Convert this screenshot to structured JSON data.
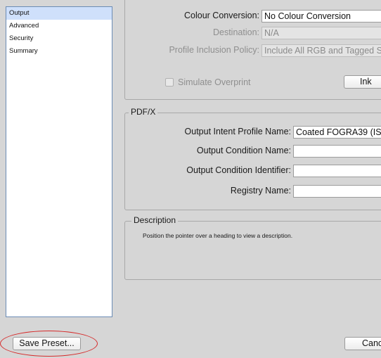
{
  "sidebar": {
    "items": [
      {
        "label": "Output",
        "selected": true
      },
      {
        "label": "Advanced",
        "selected": false
      },
      {
        "label": "Security",
        "selected": false
      },
      {
        "label": "Summary",
        "selected": false
      }
    ]
  },
  "output": {
    "colour_conversion_label": "Colour Conversion:",
    "colour_conversion_value": "No Colour Conversion",
    "destination_label": "Destination:",
    "destination_value": "N/A",
    "profile_policy_label": "Profile Inclusion Policy:",
    "profile_policy_value": "Include All RGB and Tagged S",
    "simulate_overprint_label": "Simulate Overprint",
    "ink_button_label": "Ink"
  },
  "pdfx": {
    "legend": "PDF/X",
    "output_intent_label": "Output Intent Profile Name:",
    "output_intent_value": "Coated FOGRA39 (IS",
    "output_condition_name_label": "Output Condition Name:",
    "output_condition_name_value": "",
    "output_condition_identifier_label": "Output Condition Identifier:",
    "output_condition_identifier_value": "",
    "registry_name_label": "Registry Name:",
    "registry_name_value": ""
  },
  "description": {
    "legend": "Description",
    "text": "Position the pointer over a heading to view a description."
  },
  "footer": {
    "save_preset_label": "Save Preset...",
    "cancel_label": "Canc"
  },
  "colors": {
    "selection": "#cfe0fb",
    "highlight": "#d62a2a"
  }
}
